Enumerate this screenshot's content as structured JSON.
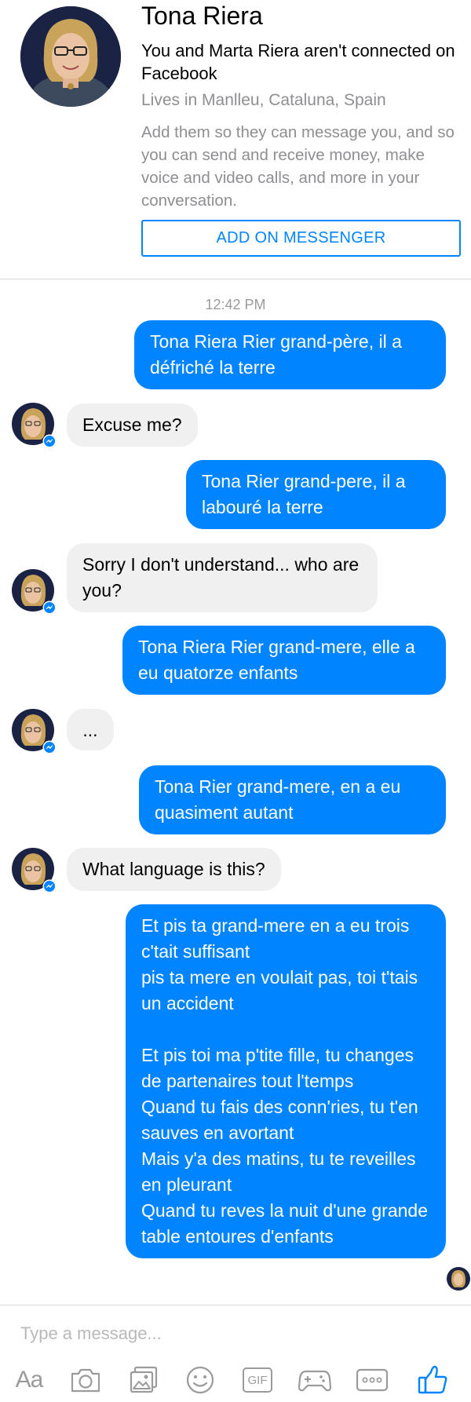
{
  "profile": {
    "name": "Tona Riera",
    "connection_text": "You and Marta Riera aren't connected on Facebook",
    "lives_in": "Lives in Manlleu, Cataluna, Spain",
    "description": "Add them so they can message you, and so you can send and receive money, make voice and video calls, and more in your conversation.",
    "add_button_label": "ADD ON MESSENGER"
  },
  "conversation": {
    "timestamp": "12:42 PM",
    "messages": [
      {
        "direction": "outgoing",
        "text": "Tona Riera Rier grand-père, il a défriché la terre"
      },
      {
        "direction": "incoming",
        "text": "Excuse me?"
      },
      {
        "direction": "outgoing",
        "text": "Tona Rier grand-pere, il a labouré la terre"
      },
      {
        "direction": "incoming",
        "text": "Sorry I don't understand... who are you?"
      },
      {
        "direction": "outgoing",
        "text": "Tona Riera Rier grand-mere, elle a eu quatorze enfants"
      },
      {
        "direction": "incoming",
        "text": "..."
      },
      {
        "direction": "outgoing",
        "text": "Tona Rier grand-mere, en a eu quasiment autant"
      },
      {
        "direction": "incoming",
        "text": "What language is this?"
      },
      {
        "direction": "outgoing",
        "text": "Et pis ta grand-mere en a eu trois c'tait suffisant\npis ta mere en voulait pas, toi t'tais un accident\n\nEt pis toi ma p'tite fille, tu changes de partenaires tout l'temps\nQuand tu fais des conn'ries, tu t'en sauves en avortant\nMais y'a des matins, tu te reveilles en pleurant\nQuand tu reves la nuit d'une grande table entoures d'enfants"
      }
    ]
  },
  "composer": {
    "placeholder": "Type a message...",
    "toolbar": {
      "text_label": "Aa",
      "gif_label": "GIF",
      "icons": [
        "text-format-icon",
        "camera-icon",
        "gallery-icon",
        "emoji-icon",
        "gif-icon",
        "game-controller-icon",
        "more-icon",
        "thumbs-up-icon"
      ]
    }
  },
  "colors": {
    "accent": "#0084ff",
    "incoming_bubble": "#f1f0f0",
    "secondary_text": "#8e8e93",
    "icon_gray": "#9b9b9b"
  }
}
